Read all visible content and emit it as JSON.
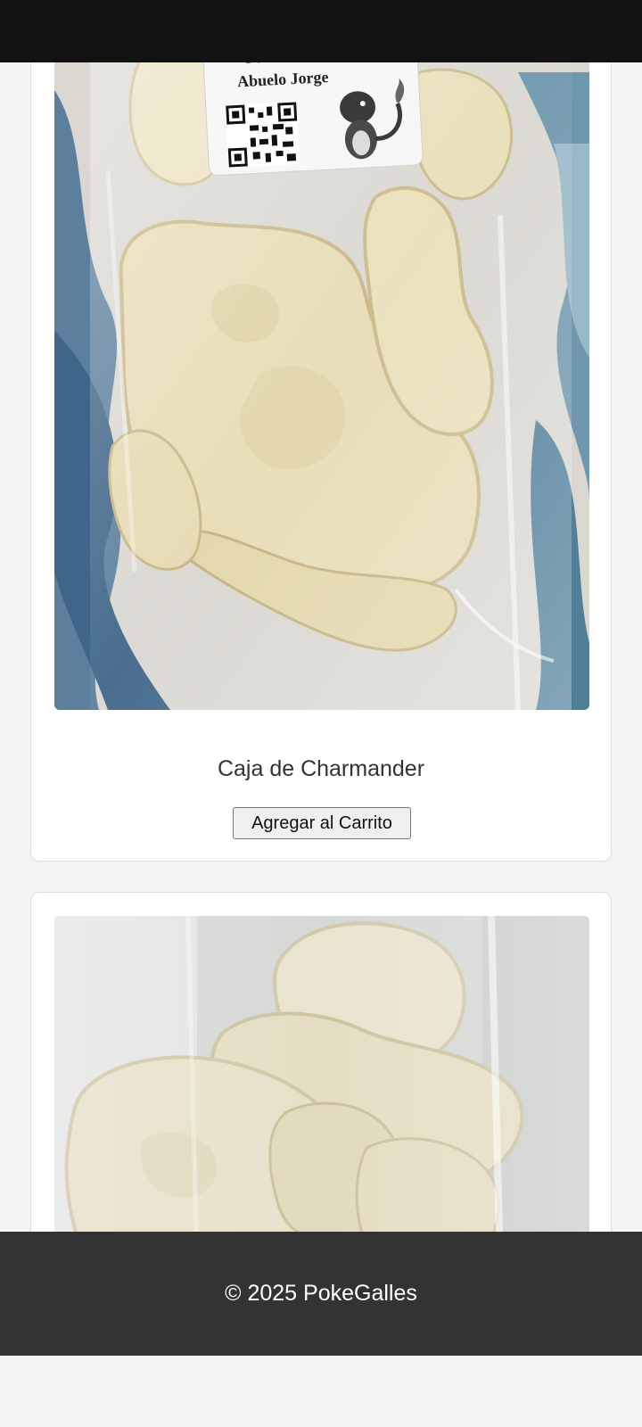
{
  "products": [
    {
      "name": "Caja de Charmander",
      "button_label": "Agregar al Carrito",
      "photo": {
        "label_line1": "Feliz Dia del Padre",
        "label_line2": "Abuelo Jorge",
        "icon": "charmander-cookie-bag"
      }
    },
    {
      "photo": {
        "icon": "squirtle-cookie-bag"
      }
    }
  ],
  "footer": {
    "text": "© 2025 PokeGalles"
  },
  "colors": {
    "top_bar": "#121212",
    "page_background": "#f3f3f3",
    "card_background": "#ffffff",
    "footer_background": "#333333",
    "footer_text": "#ffffff"
  }
}
